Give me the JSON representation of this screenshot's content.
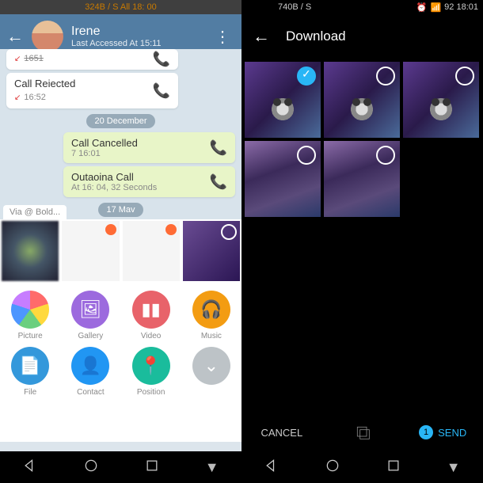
{
  "left": {
    "status": "324B / S All 18: 00",
    "header": {
      "name": "Irene",
      "subtitle": "Last Accessed At 15:11"
    },
    "chat": {
      "msg1_time": "1651",
      "msg2_title": "Call Reiected",
      "msg2_time": "16:52",
      "date1": "20 December",
      "msg3_title": "Call Cancelled",
      "msg3_time": "7 16:01",
      "msg4_title": "Outaoina Call",
      "msg4_time": "At 16: 04, 32 Seconds",
      "date2": "17 Mav",
      "via": "Via @ Bold..."
    },
    "attach": {
      "picture": "Picture",
      "gallery": "Gallery",
      "video": "Video",
      "music": "Music",
      "file": "File",
      "contact": "Contact",
      "position": "Position"
    }
  },
  "right": {
    "status": "740B / S",
    "status_r": "92  18:01",
    "title": "Download",
    "cancel": "CANCEL",
    "send": "SEND",
    "count": "1"
  }
}
